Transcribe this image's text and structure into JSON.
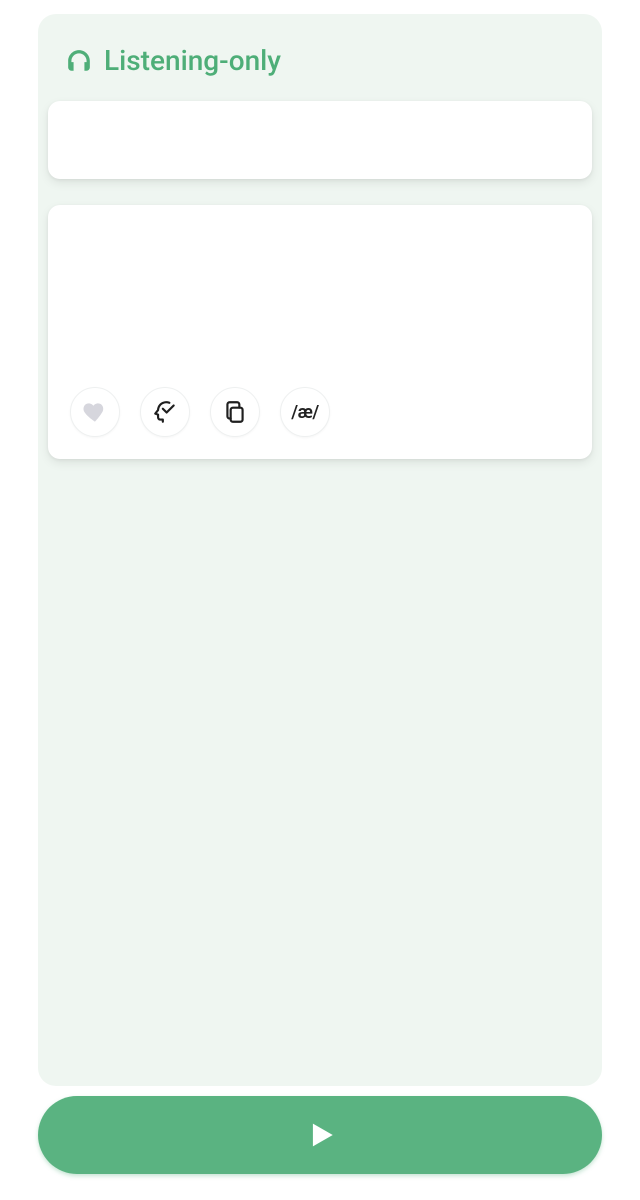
{
  "colors": {
    "accent": "#5ab381",
    "accentText": "#4eae78",
    "surface": "#eff6f1"
  },
  "header": {
    "icon": "headphones-icon",
    "title": "Listening-only"
  },
  "cards": {
    "top": {
      "content": ""
    },
    "main": {
      "content": ""
    }
  },
  "actions": {
    "favorite": {
      "icon": "heart-icon"
    },
    "learn": {
      "icon": "head-check-icon"
    },
    "copy": {
      "icon": "copy-icon"
    },
    "ipa": {
      "label": "/æ/"
    }
  },
  "footer": {
    "playIcon": "play-icon"
  }
}
